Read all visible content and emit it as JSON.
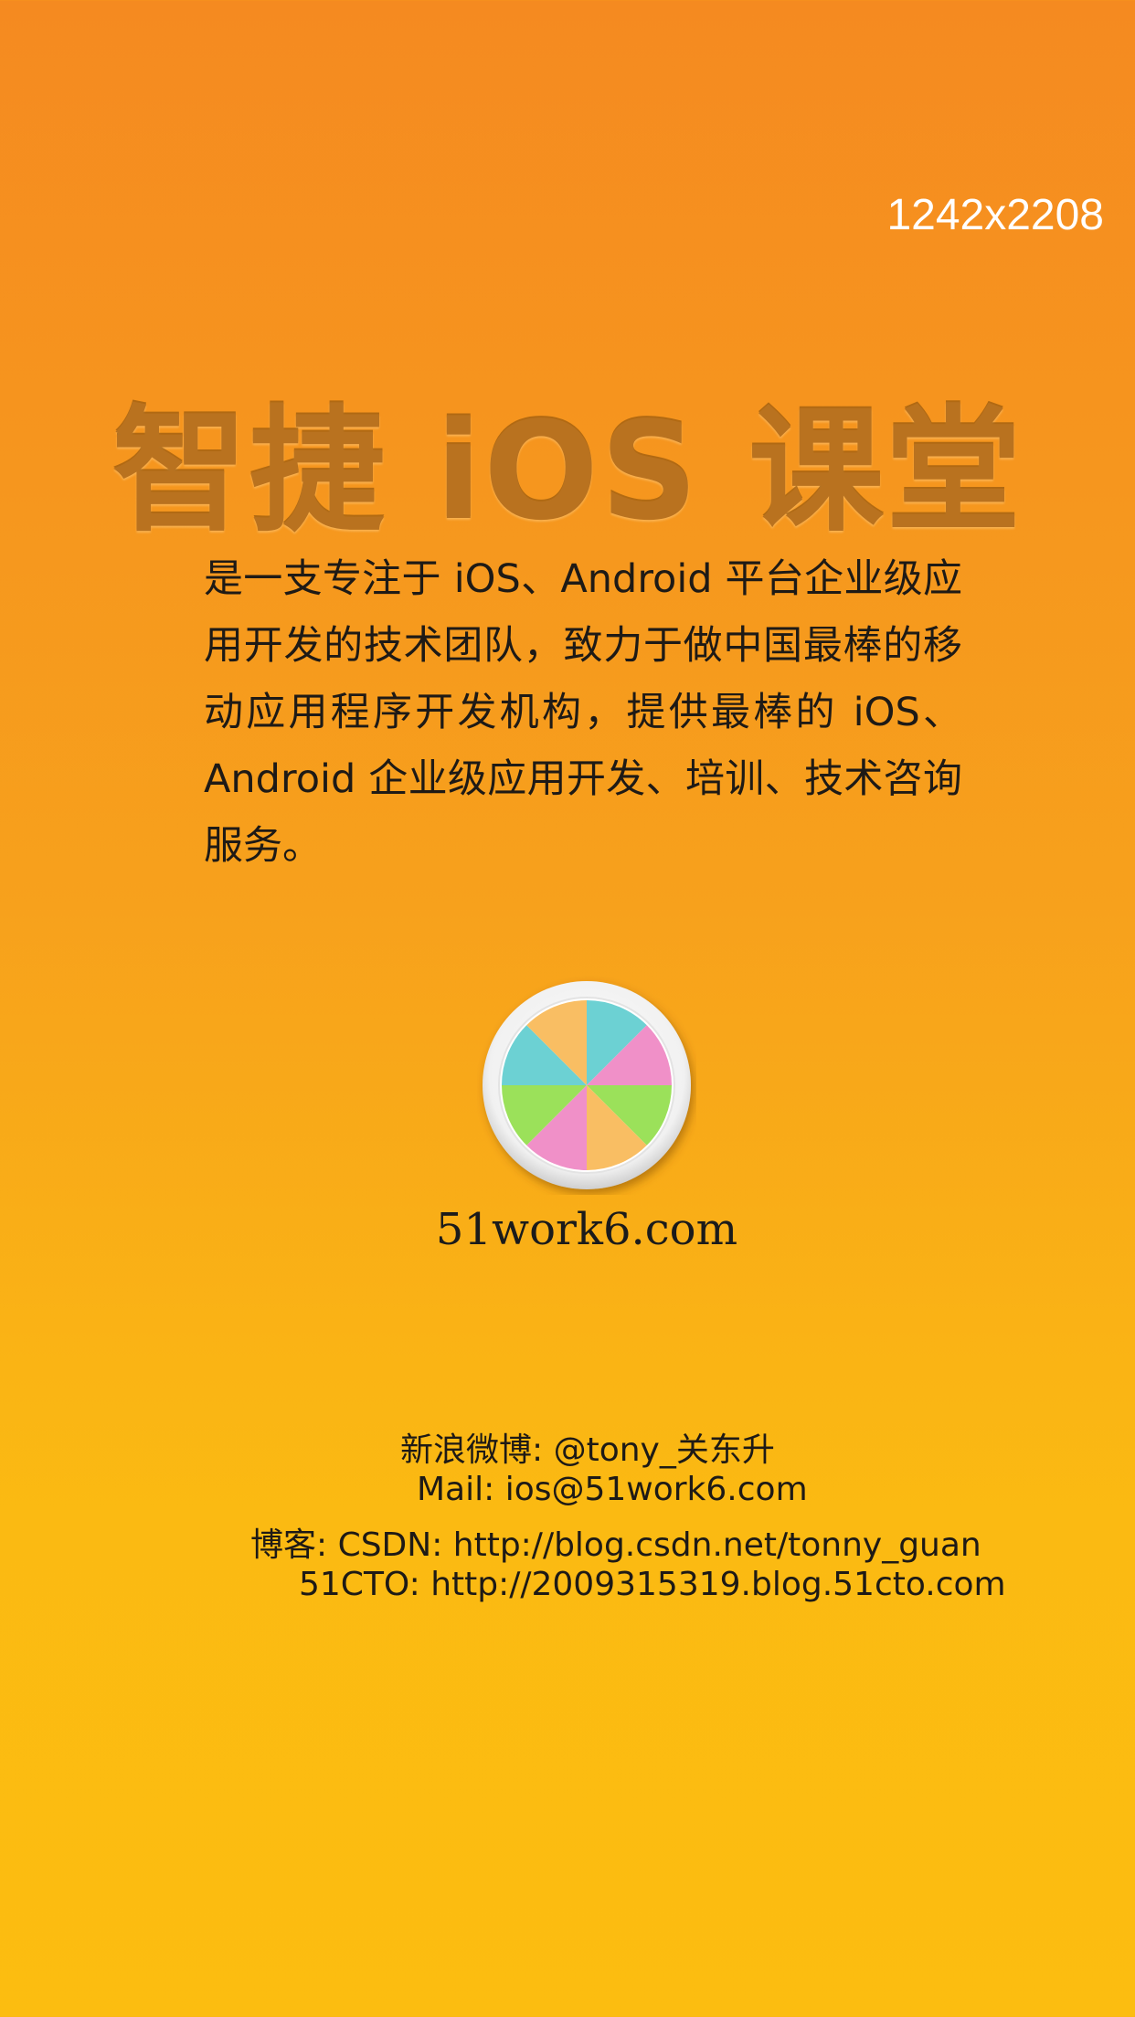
{
  "screen": {
    "size_label": "1242x2208",
    "background_colors": [
      "#F58A20",
      "#FCBD10"
    ]
  },
  "title": "智捷 iOS 课堂",
  "intro": "是一支专注于 iOS、Android 平台企业级应用开发的技术团队，致力于做中国最棒的移动应用程序开发机构，提供最棒的 iOS、Android 企业级应用开发、培训、技术咨询服务。",
  "logo": {
    "icon": "pinwheel-logo-icon",
    "text": "51work6.com",
    "colors": [
      "#F9BE63",
      "#6CD1D3",
      "#F090C8",
      "#9BE15A"
    ]
  },
  "contacts": {
    "weibo": "新浪微博: @tony_关东升",
    "mail": "Mail: ios@51work6.com",
    "blog_csdn": "博客: CSDN: http://blog.csdn.net/tonny_guan",
    "blog_51cto": "51CTO: http://2009315319.blog.51cto.com"
  }
}
